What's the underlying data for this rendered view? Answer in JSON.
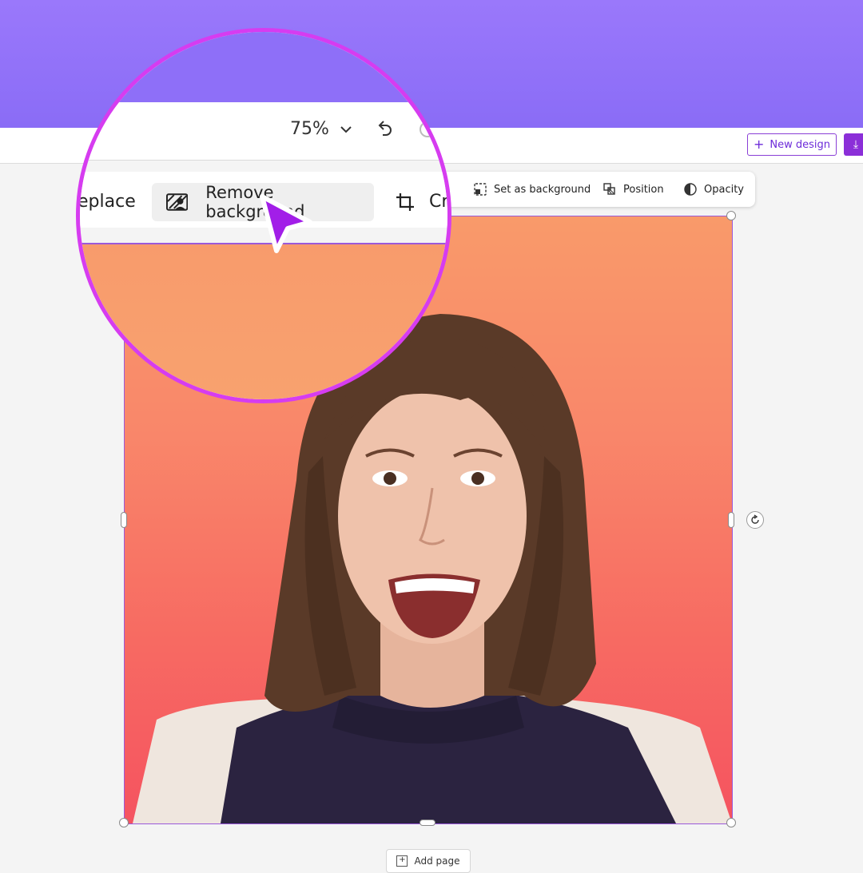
{
  "header": {
    "new_design_label": "New design",
    "download_icon": "download-icon"
  },
  "context_toolbar": {
    "set_as_background_label": "Set as background",
    "position_label": "Position",
    "opacity_label": "Opacity"
  },
  "canvas": {
    "add_page_label": "Add page"
  },
  "magnifier": {
    "zoom_value": "75%",
    "replace_label": "eplace",
    "remove_background_label": "Remove background",
    "crop_label": "Cr"
  },
  "colors": {
    "accent": "#8b2fd8",
    "banner": "#9a78fb",
    "magnifier_ring": "#d63cf0",
    "cursor": "#a21ee8"
  }
}
